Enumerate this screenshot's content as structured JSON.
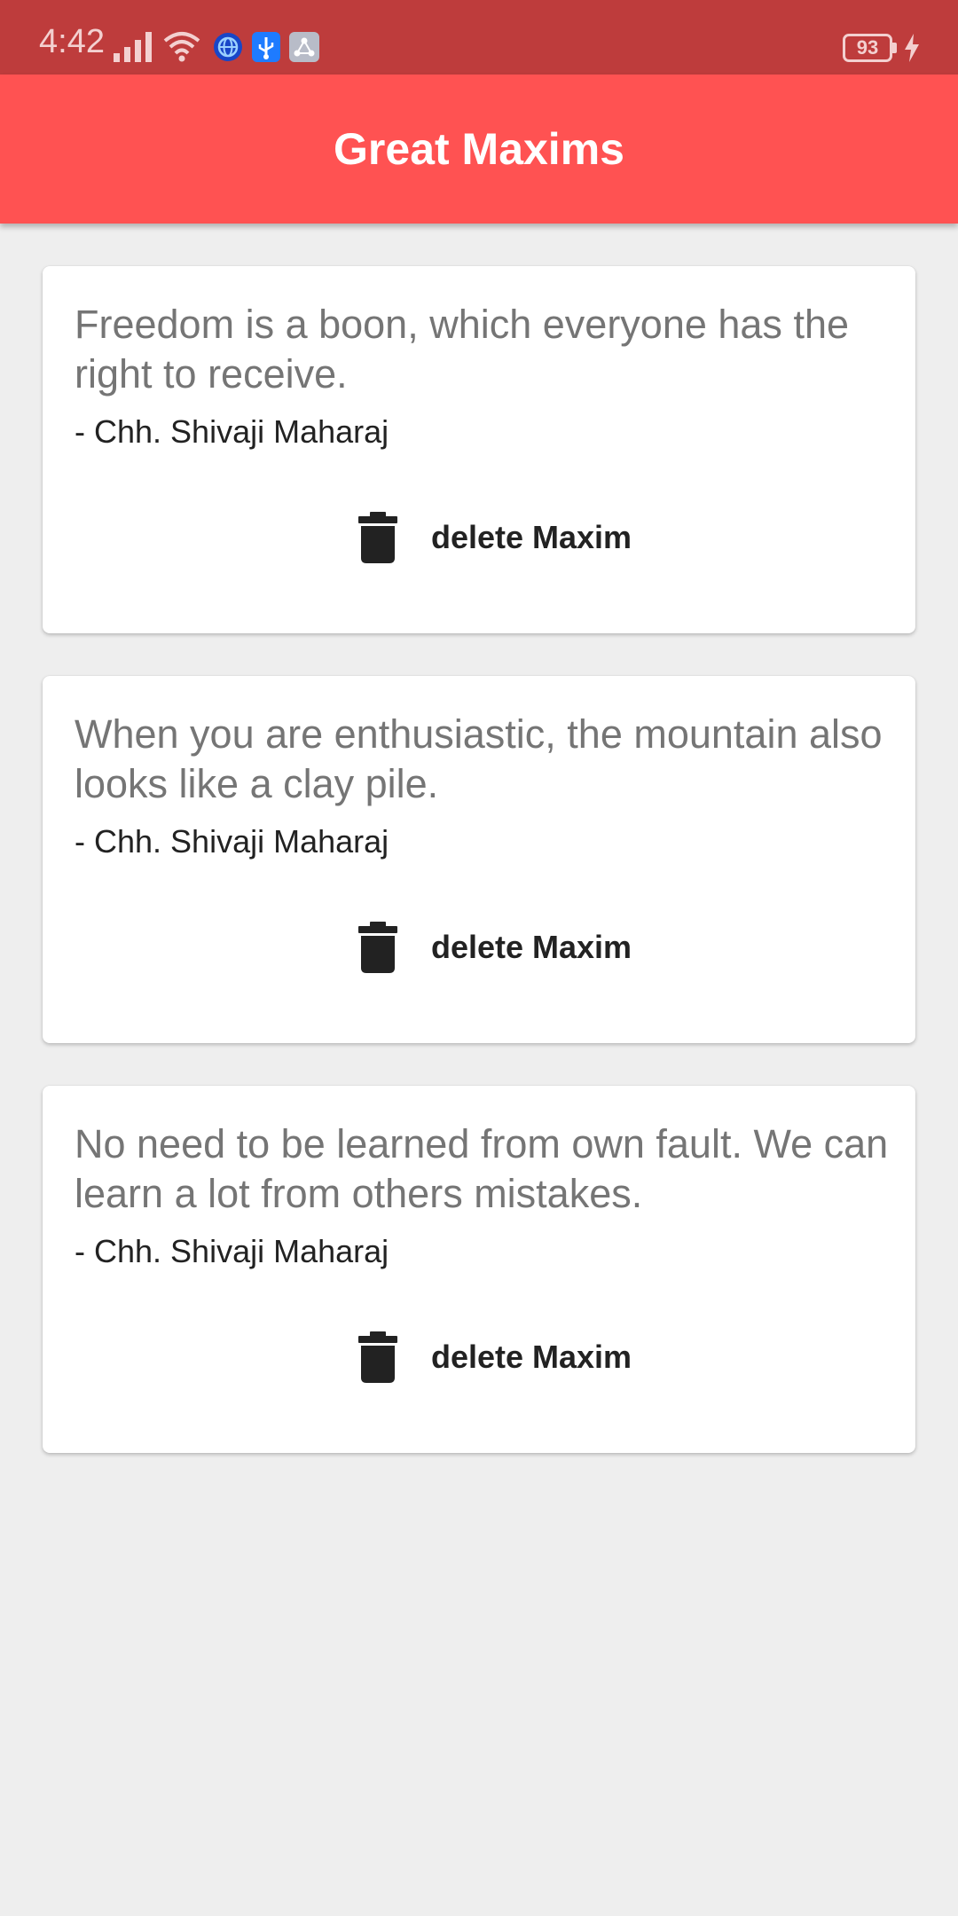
{
  "status_bar": {
    "time": "4:42",
    "battery": "93",
    "icons": [
      "signal-icon",
      "wifi-icon",
      "vpn-globe-icon",
      "usb-icon",
      "app-notification-icon",
      "battery-icon",
      "charging-bolt-icon"
    ]
  },
  "app_bar": {
    "title": "Great Maxims",
    "color": "#ff5252"
  },
  "maxims": [
    {
      "quote": "Freedom is a boon, which everyone has the right to receive.",
      "author": "- Chh. Shivaji Maharaj",
      "delete_label": "delete Maxim"
    },
    {
      "quote": "When you are enthusiastic, the mountain also looks like a clay pile.",
      "author": "- Chh. Shivaji Maharaj",
      "delete_label": "delete Maxim"
    },
    {
      "quote": "No need to be learned from own fault. We can learn a lot from others mistakes.",
      "author": "- Chh. Shivaji Maharaj",
      "delete_label": "delete Maxim"
    }
  ]
}
